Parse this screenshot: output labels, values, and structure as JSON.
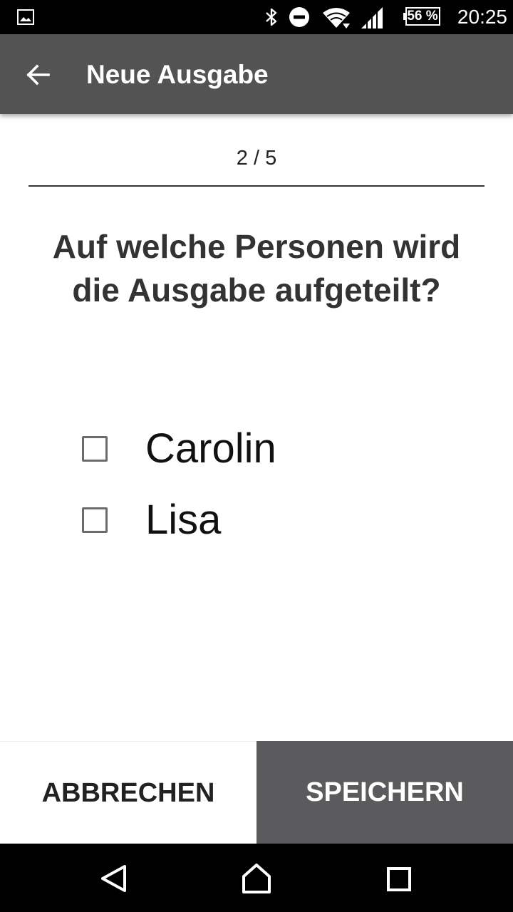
{
  "status_bar": {
    "battery_percent": "56 %",
    "time": "20:25",
    "icons": [
      "gallery-notification-icon",
      "bluetooth-icon",
      "do-not-disturb-icon",
      "wifi-icon",
      "signal-icon",
      "battery-icon"
    ]
  },
  "toolbar": {
    "back_icon": "arrow-left-icon",
    "title": "Neue Ausgabe"
  },
  "wizard": {
    "step": "2 / 5",
    "question": "Auf welche Personen wird die Ausgabe aufgeteilt?"
  },
  "persons": [
    {
      "name": "Carolin",
      "checked": false
    },
    {
      "name": "Lisa",
      "checked": false
    }
  ],
  "actions": {
    "cancel_label": "ABBRECHEN",
    "save_label": "SPEICHERN"
  },
  "nav_bar": {
    "icons": [
      "nav-back-icon",
      "nav-home-icon",
      "nav-recents-icon"
    ]
  },
  "colors": {
    "toolbar": "#535353",
    "save_button": "#5b5b5d",
    "system_bars": "#000000"
  }
}
